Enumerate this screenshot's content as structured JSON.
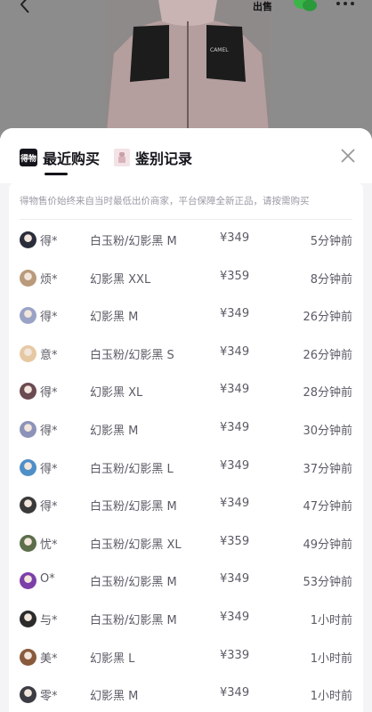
{
  "header": {
    "sell_label": "出售"
  },
  "tabs": [
    {
      "label": "最近购买",
      "icon": "dewu-logo-icon",
      "logo_text": "得物"
    },
    {
      "label": "鉴别记录",
      "icon": "authentication-icon"
    }
  ],
  "notice": "得物售价始终来自当时最低出价商家，平台保障全新正品，请按需购买",
  "purchases": [
    {
      "name": "得*",
      "spec": "白玉粉/幻影黑 M",
      "price": "¥349",
      "time": "5分钟前",
      "avatar_color": "#2a2d3a"
    },
    {
      "name": "烦*",
      "spec": "幻影黑 XXL",
      "price": "¥359",
      "time": "8分钟前",
      "avatar_color": "#b99a7a"
    },
    {
      "name": "得*",
      "spec": "幻影黑 M",
      "price": "¥349",
      "time": "26分钟前",
      "avatar_color": "#9aa3c6"
    },
    {
      "name": "意*",
      "spec": "白玉粉/幻影黑 S",
      "price": "¥349",
      "time": "26分钟前",
      "avatar_color": "#e6c9a3"
    },
    {
      "name": "得*",
      "spec": "幻影黑 XL",
      "price": "¥349",
      "time": "28分钟前",
      "avatar_color": "#6c4a52"
    },
    {
      "name": "得*",
      "spec": "幻影黑 M",
      "price": "¥349",
      "time": "30分钟前",
      "avatar_color": "#8d93b8"
    },
    {
      "name": "得*",
      "spec": "白玉粉/幻影黑 L",
      "price": "¥349",
      "time": "37分钟前",
      "avatar_color": "#4f8fc8"
    },
    {
      "name": "得*",
      "spec": "白玉粉/幻影黑 M",
      "price": "¥349",
      "time": "47分钟前",
      "avatar_color": "#3a3a3a"
    },
    {
      "name": "忧*",
      "spec": "白玉粉/幻影黑 XL",
      "price": "¥359",
      "time": "49分钟前",
      "avatar_color": "#5c6e4a"
    },
    {
      "name": "O*",
      "spec": "白玉粉/幻影黑 M",
      "price": "¥349",
      "time": "53分钟前",
      "avatar_color": "#7c3fa8"
    },
    {
      "name": "与*",
      "spec": "白玉粉/幻影黑 M",
      "price": "¥349",
      "time": "1小时前",
      "avatar_color": "#2b2b2b"
    },
    {
      "name": "美*",
      "spec": "幻影黑 L",
      "price": "¥339",
      "time": "1小时前",
      "avatar_color": "#8a5a3c"
    },
    {
      "name": "零*",
      "spec": "幻影黑 M",
      "price": "¥349",
      "time": "1小时前",
      "avatar_color": "#3c3c44"
    }
  ]
}
